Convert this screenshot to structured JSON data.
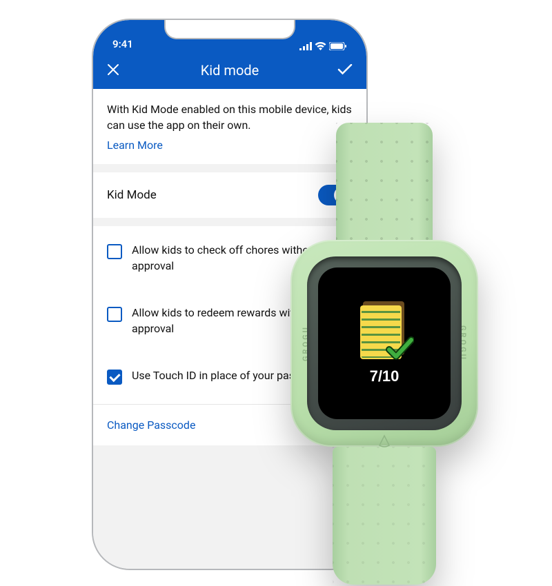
{
  "statusbar": {
    "time": "9:41"
  },
  "header": {
    "title": "Kid mode"
  },
  "intro": {
    "text": "With Kid Mode enabled on this mobile device, kids can use the app on their own.",
    "learn_more": "Learn More"
  },
  "toggle": {
    "label": "Kid Mode",
    "on": true
  },
  "options": [
    {
      "label": "Allow kids to check off chores without approval",
      "checked": false
    },
    {
      "label": "Allow kids to redeem rewards without approval",
      "checked": false
    },
    {
      "label": "Use Touch ID in place of your passcode",
      "checked": true
    }
  ],
  "change_passcode": "Change Passcode",
  "watch": {
    "side_text": "GROGU",
    "count": "7/10"
  },
  "colors": {
    "brand_blue": "#0a5ac2",
    "watch_band": "#bde0b1"
  }
}
